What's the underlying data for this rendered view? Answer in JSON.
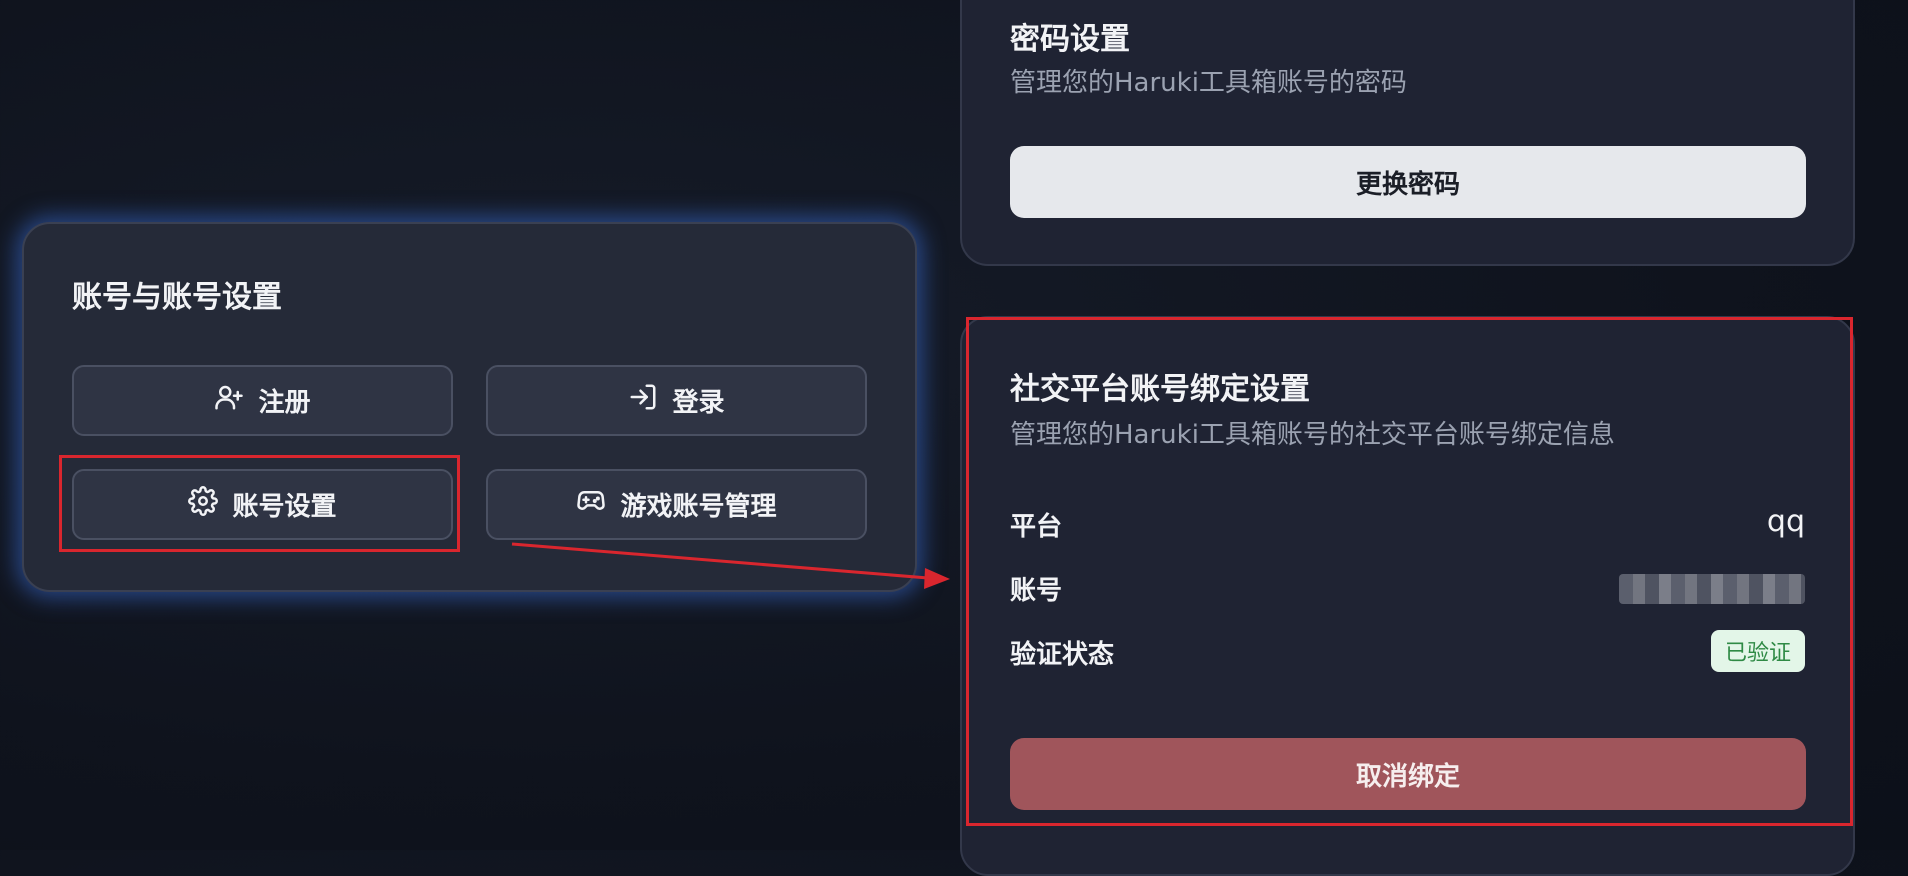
{
  "account_card": {
    "title": "账号与账号设置",
    "buttons": {
      "register": "注册",
      "login": "登录",
      "account_settings": "账号设置",
      "game_accounts": "游戏账号管理"
    }
  },
  "password_card": {
    "title": "密码设置",
    "description": "管理您的Haruki工具箱账号的密码",
    "button": "更换密码"
  },
  "social_card": {
    "title": "社交平台账号绑定设置",
    "description": "管理您的Haruki工具箱账号的社交平台账号绑定信息",
    "rows": {
      "platform_label": "平台",
      "platform_value": "qq",
      "account_label": "账号",
      "status_label": "验证状态",
      "status_badge": "已验证"
    },
    "unbind_button": "取消绑定"
  },
  "colors": {
    "highlight_red": "#d9262e",
    "glow_blue": "#3b6ed6",
    "unbind_button": "#a0555b",
    "verified_badge_bg": "#e3f6e8",
    "verified_badge_text": "#2f8a45"
  },
  "icons": [
    "user-plus-icon",
    "login-icon",
    "gear-icon",
    "gamepad-icon"
  ]
}
